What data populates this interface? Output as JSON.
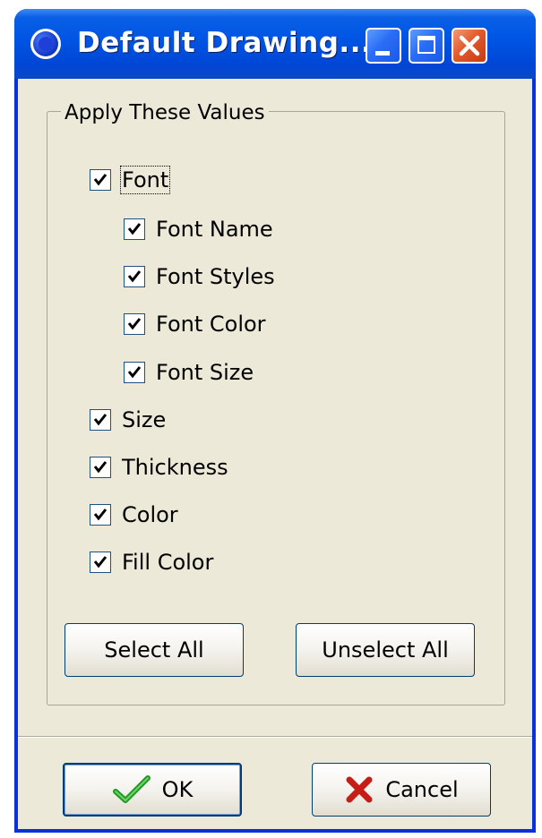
{
  "window": {
    "title": "Default Drawing...",
    "colors": {
      "titlebar": "#0054e3",
      "client": "#ece9d8",
      "close": "#e35a2d"
    }
  },
  "group": {
    "label": "Apply These Values",
    "items": [
      {
        "label": "Font",
        "checked": true,
        "level": 0,
        "focused": true
      },
      {
        "label": "Font Name",
        "checked": true,
        "level": 1
      },
      {
        "label": "Font Styles",
        "checked": true,
        "level": 1
      },
      {
        "label": "Font Color",
        "checked": true,
        "level": 1
      },
      {
        "label": "Font Size",
        "checked": true,
        "level": 1
      },
      {
        "label": "Size",
        "checked": true,
        "level": 0
      },
      {
        "label": "Thickness",
        "checked": true,
        "level": 0
      },
      {
        "label": "Color",
        "checked": true,
        "level": 0
      },
      {
        "label": "Fill Color",
        "checked": true,
        "level": 0
      }
    ],
    "select_all": "Select All",
    "unselect_all": "Unselect All"
  },
  "footer": {
    "ok_label": "OK",
    "ok_icon": "green-checkmark-icon",
    "cancel_label": "Cancel",
    "cancel_icon": "red-x-icon"
  }
}
